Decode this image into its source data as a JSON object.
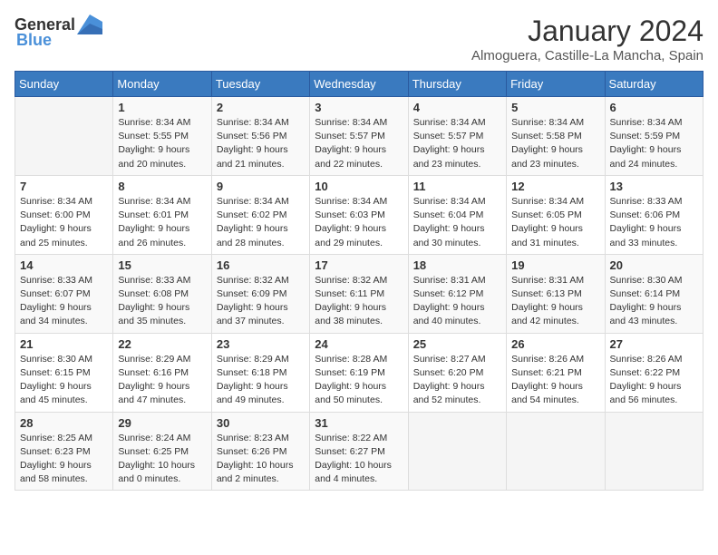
{
  "header": {
    "logo_general": "General",
    "logo_blue": "Blue",
    "month_title": "January 2024",
    "location": "Almoguera, Castille-La Mancha, Spain"
  },
  "weekdays": [
    "Sunday",
    "Monday",
    "Tuesday",
    "Wednesday",
    "Thursday",
    "Friday",
    "Saturday"
  ],
  "weeks": [
    [
      {
        "day": "",
        "sunrise": "",
        "sunset": "",
        "daylight": ""
      },
      {
        "day": "1",
        "sunrise": "Sunrise: 8:34 AM",
        "sunset": "Sunset: 5:55 PM",
        "daylight": "Daylight: 9 hours and 20 minutes."
      },
      {
        "day": "2",
        "sunrise": "Sunrise: 8:34 AM",
        "sunset": "Sunset: 5:56 PM",
        "daylight": "Daylight: 9 hours and 21 minutes."
      },
      {
        "day": "3",
        "sunrise": "Sunrise: 8:34 AM",
        "sunset": "Sunset: 5:57 PM",
        "daylight": "Daylight: 9 hours and 22 minutes."
      },
      {
        "day": "4",
        "sunrise": "Sunrise: 8:34 AM",
        "sunset": "Sunset: 5:57 PM",
        "daylight": "Daylight: 9 hours and 23 minutes."
      },
      {
        "day": "5",
        "sunrise": "Sunrise: 8:34 AM",
        "sunset": "Sunset: 5:58 PM",
        "daylight": "Daylight: 9 hours and 23 minutes."
      },
      {
        "day": "6",
        "sunrise": "Sunrise: 8:34 AM",
        "sunset": "Sunset: 5:59 PM",
        "daylight": "Daylight: 9 hours and 24 minutes."
      }
    ],
    [
      {
        "day": "7",
        "sunrise": "Sunrise: 8:34 AM",
        "sunset": "Sunset: 6:00 PM",
        "daylight": "Daylight: 9 hours and 25 minutes."
      },
      {
        "day": "8",
        "sunrise": "Sunrise: 8:34 AM",
        "sunset": "Sunset: 6:01 PM",
        "daylight": "Daylight: 9 hours and 26 minutes."
      },
      {
        "day": "9",
        "sunrise": "Sunrise: 8:34 AM",
        "sunset": "Sunset: 6:02 PM",
        "daylight": "Daylight: 9 hours and 28 minutes."
      },
      {
        "day": "10",
        "sunrise": "Sunrise: 8:34 AM",
        "sunset": "Sunset: 6:03 PM",
        "daylight": "Daylight: 9 hours and 29 minutes."
      },
      {
        "day": "11",
        "sunrise": "Sunrise: 8:34 AM",
        "sunset": "Sunset: 6:04 PM",
        "daylight": "Daylight: 9 hours and 30 minutes."
      },
      {
        "day": "12",
        "sunrise": "Sunrise: 8:34 AM",
        "sunset": "Sunset: 6:05 PM",
        "daylight": "Daylight: 9 hours and 31 minutes."
      },
      {
        "day": "13",
        "sunrise": "Sunrise: 8:33 AM",
        "sunset": "Sunset: 6:06 PM",
        "daylight": "Daylight: 9 hours and 33 minutes."
      }
    ],
    [
      {
        "day": "14",
        "sunrise": "Sunrise: 8:33 AM",
        "sunset": "Sunset: 6:07 PM",
        "daylight": "Daylight: 9 hours and 34 minutes."
      },
      {
        "day": "15",
        "sunrise": "Sunrise: 8:33 AM",
        "sunset": "Sunset: 6:08 PM",
        "daylight": "Daylight: 9 hours and 35 minutes."
      },
      {
        "day": "16",
        "sunrise": "Sunrise: 8:32 AM",
        "sunset": "Sunset: 6:09 PM",
        "daylight": "Daylight: 9 hours and 37 minutes."
      },
      {
        "day": "17",
        "sunrise": "Sunrise: 8:32 AM",
        "sunset": "Sunset: 6:11 PM",
        "daylight": "Daylight: 9 hours and 38 minutes."
      },
      {
        "day": "18",
        "sunrise": "Sunrise: 8:31 AM",
        "sunset": "Sunset: 6:12 PM",
        "daylight": "Daylight: 9 hours and 40 minutes."
      },
      {
        "day": "19",
        "sunrise": "Sunrise: 8:31 AM",
        "sunset": "Sunset: 6:13 PM",
        "daylight": "Daylight: 9 hours and 42 minutes."
      },
      {
        "day": "20",
        "sunrise": "Sunrise: 8:30 AM",
        "sunset": "Sunset: 6:14 PM",
        "daylight": "Daylight: 9 hours and 43 minutes."
      }
    ],
    [
      {
        "day": "21",
        "sunrise": "Sunrise: 8:30 AM",
        "sunset": "Sunset: 6:15 PM",
        "daylight": "Daylight: 9 hours and 45 minutes."
      },
      {
        "day": "22",
        "sunrise": "Sunrise: 8:29 AM",
        "sunset": "Sunset: 6:16 PM",
        "daylight": "Daylight: 9 hours and 47 minutes."
      },
      {
        "day": "23",
        "sunrise": "Sunrise: 8:29 AM",
        "sunset": "Sunset: 6:18 PM",
        "daylight": "Daylight: 9 hours and 49 minutes."
      },
      {
        "day": "24",
        "sunrise": "Sunrise: 8:28 AM",
        "sunset": "Sunset: 6:19 PM",
        "daylight": "Daylight: 9 hours and 50 minutes."
      },
      {
        "day": "25",
        "sunrise": "Sunrise: 8:27 AM",
        "sunset": "Sunset: 6:20 PM",
        "daylight": "Daylight: 9 hours and 52 minutes."
      },
      {
        "day": "26",
        "sunrise": "Sunrise: 8:26 AM",
        "sunset": "Sunset: 6:21 PM",
        "daylight": "Daylight: 9 hours and 54 minutes."
      },
      {
        "day": "27",
        "sunrise": "Sunrise: 8:26 AM",
        "sunset": "Sunset: 6:22 PM",
        "daylight": "Daylight: 9 hours and 56 minutes."
      }
    ],
    [
      {
        "day": "28",
        "sunrise": "Sunrise: 8:25 AM",
        "sunset": "Sunset: 6:23 PM",
        "daylight": "Daylight: 9 hours and 58 minutes."
      },
      {
        "day": "29",
        "sunrise": "Sunrise: 8:24 AM",
        "sunset": "Sunset: 6:25 PM",
        "daylight": "Daylight: 10 hours and 0 minutes."
      },
      {
        "day": "30",
        "sunrise": "Sunrise: 8:23 AM",
        "sunset": "Sunset: 6:26 PM",
        "daylight": "Daylight: 10 hours and 2 minutes."
      },
      {
        "day": "31",
        "sunrise": "Sunrise: 8:22 AM",
        "sunset": "Sunset: 6:27 PM",
        "daylight": "Daylight: 10 hours and 4 minutes."
      },
      {
        "day": "",
        "sunrise": "",
        "sunset": "",
        "daylight": ""
      },
      {
        "day": "",
        "sunrise": "",
        "sunset": "",
        "daylight": ""
      },
      {
        "day": "",
        "sunrise": "",
        "sunset": "",
        "daylight": ""
      }
    ]
  ]
}
